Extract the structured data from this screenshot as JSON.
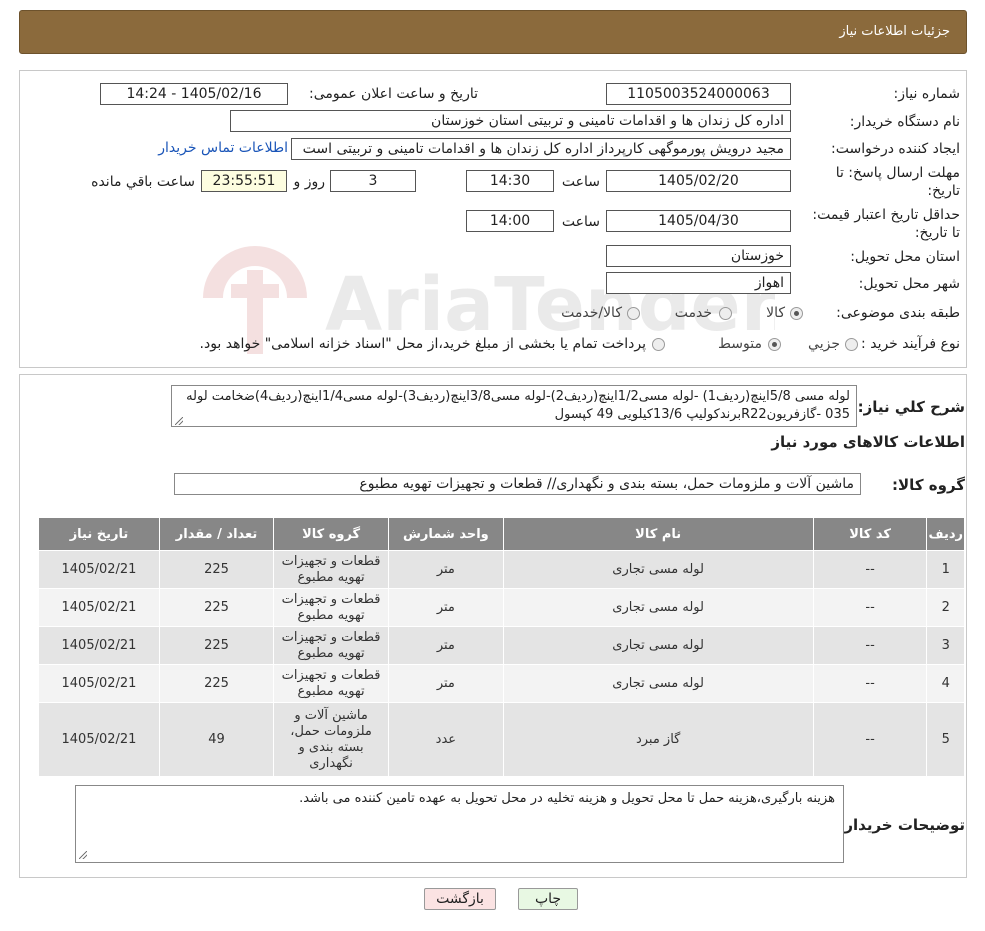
{
  "header": {
    "title": "جزئیات اطلاعات نیاز"
  },
  "form": {
    "need_number_label": "شماره نیاز:",
    "need_number": "1105003524000063",
    "announce_label": "تاریخ و ساعت اعلان عمومی:",
    "announce_value": "1405/02/16 - 14:24",
    "buyer_org_label": "نام دستگاه خریدار:",
    "buyer_org": "اداره کل زندان ها و اقدامات تامینی و تربیتی استان خوزستان",
    "requester_label": "ایجاد کننده درخواست:",
    "requester": "مجید درویش پورموگهی کارپرداز اداره کل زندان ها و اقدامات تامینی و تربیتی است",
    "contact_link": "اطلاعات تماس خریدار",
    "deadline_label": "مهلت ارسال پاسخ: تا تاریخ:",
    "deadline_date": "1405/02/20",
    "time_label": "ساعت",
    "deadline_time": "14:30",
    "days_value": "3",
    "days_label": "روز و",
    "remaining_time": "23:55:51",
    "remaining_label": "ساعت باقي مانده",
    "validity_label": "حداقل تاریخ اعتبار قیمت: تا تاریخ:",
    "validity_date": "1405/04/30",
    "validity_time": "14:00",
    "province_label": "استان محل تحویل:",
    "province": "خوزستان",
    "city_label": "شهر محل تحویل:",
    "city": "اهواز",
    "category_label": "طبقه بندی موضوعی:",
    "category_options": [
      "کالا",
      "خدمت",
      "کالا/خدمت"
    ],
    "process_label": "نوع فرآیند خرید :",
    "process_options": [
      "جزیي",
      "متوسط"
    ],
    "process_note": "پرداخت تمام یا بخشی از مبلغ خرید،از محل \"اسناد خزانه اسلامی\" خواهد بود."
  },
  "summary": {
    "label": "شرح کلي نياز:",
    "text": "لوله مسی 5/8اینچ(ردیف1) -لوله مسی1/2اینچ(ردیف2)-لوله مسی3/8اینچ(ردیف3)-لوله مسی1/4اینچ(ردیف4)ضخامت لوله 035 -گازفریونR22برندکولیپ 13/6کیلویی 49 کپسول"
  },
  "goods": {
    "section_title": "اطلاعات کالاهای مورد نیاز",
    "group_label": "گروه کالا:",
    "group_value": "ماشین آلات و ملزومات حمل، بسته بندی و نگهداری//  قطعات و تجهیزات تهویه مطبوع",
    "columns": [
      "ردیف",
      "کد کالا",
      "نام کالا",
      "واحد شمارش",
      "گروه کالا",
      "تعداد / مقدار",
      "تاریخ نیاز"
    ],
    "rows": [
      {
        "idx": "1",
        "code": "--",
        "name": "لوله مسی تجاری",
        "unit": "متر",
        "group": "قطعات و تجهیزات تهویه مطبوع",
        "qty": "225",
        "date": "1405/02/21"
      },
      {
        "idx": "2",
        "code": "--",
        "name": "لوله مسی تجاری",
        "unit": "متر",
        "group": "قطعات و تجهیزات تهویه مطبوع",
        "qty": "225",
        "date": "1405/02/21"
      },
      {
        "idx": "3",
        "code": "--",
        "name": "لوله مسی تجاری",
        "unit": "متر",
        "group": "قطعات و تجهیزات تهویه مطبوع",
        "qty": "225",
        "date": "1405/02/21"
      },
      {
        "idx": "4",
        "code": "--",
        "name": "لوله مسی تجاری",
        "unit": "متر",
        "group": "قطعات و تجهیزات تهویه مطبوع",
        "qty": "225",
        "date": "1405/02/21"
      },
      {
        "idx": "5",
        "code": "--",
        "name": "گاز مبرد",
        "unit": "عدد",
        "group": "ماشین آلات و ملزومات حمل، بسته بندی و نگهداری",
        "qty": "49",
        "date": "1405/02/21"
      }
    ]
  },
  "buyer_notes": {
    "label": "توضیحات خریدار:",
    "text": "هزینه بارگیری،هزینه حمل تا محل تحویل و هزینه تخلیه در محل تحویل به عهده تامین کننده می باشد."
  },
  "buttons": {
    "print": "چاپ",
    "back": "بازگشت"
  },
  "watermark": {
    "brand": "AriaTender.neT"
  }
}
